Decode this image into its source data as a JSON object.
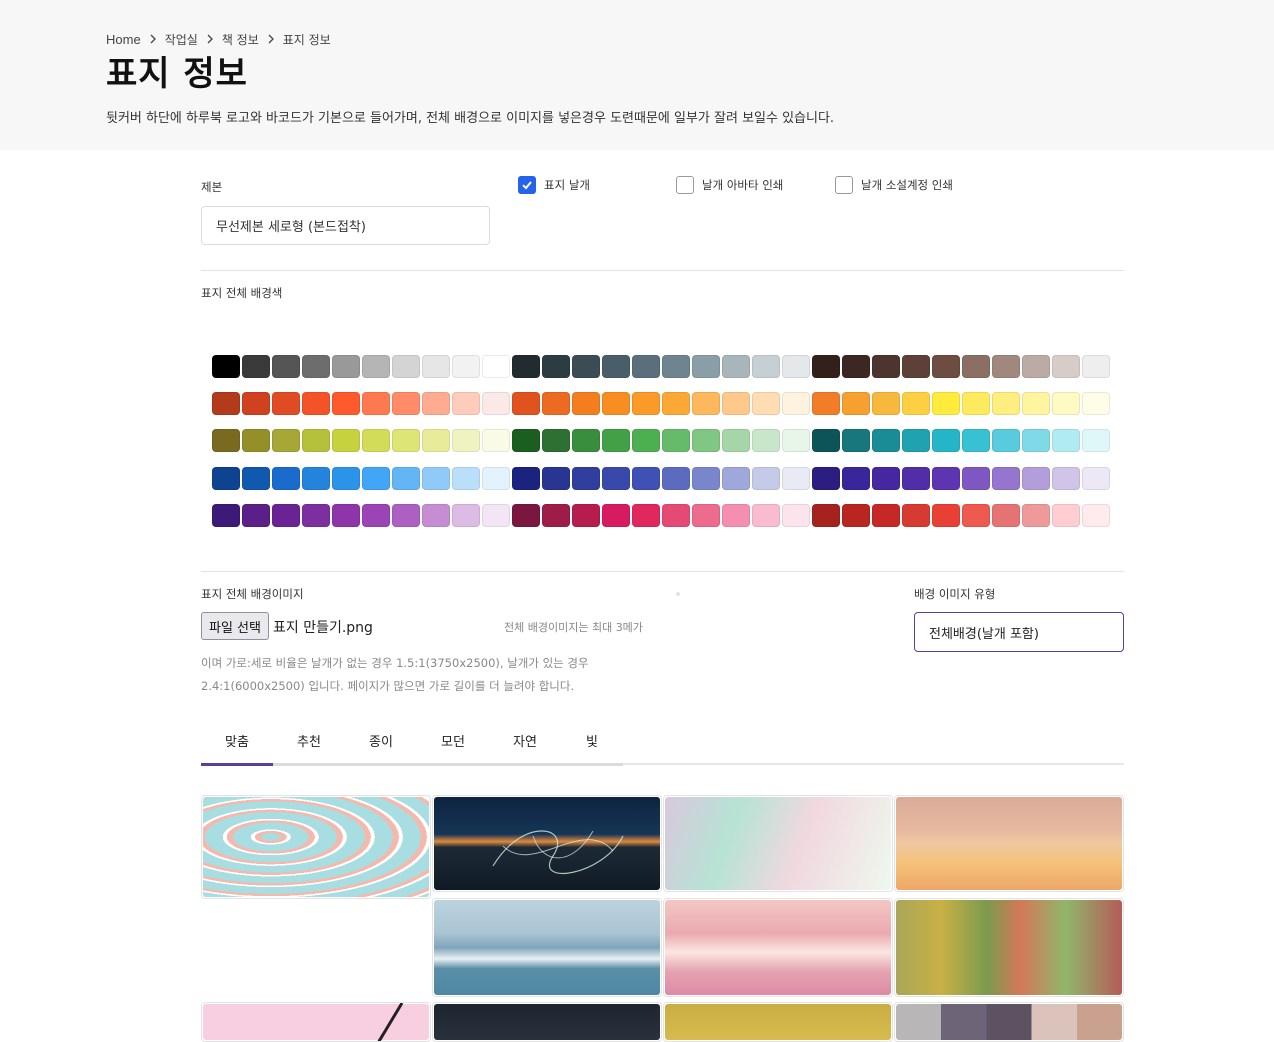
{
  "breadcrumb": [
    {
      "label": "Home"
    },
    {
      "label": "작업실"
    },
    {
      "label": "책 정보"
    },
    {
      "label": "표지 정보"
    }
  ],
  "page": {
    "title": "표지 정보",
    "description": "뒷커버 하단에 하루북 로고와 바코드가 기본으로 들어가며, 전체 배경으로 이미지를 넣은경우 도련때문에 일부가 잘려 보일수 있습니다."
  },
  "binding": {
    "label": "제본",
    "value": "무선제본 세로형 (본드접착)"
  },
  "options": [
    {
      "label": "표지 날개",
      "checked": true
    },
    {
      "label": "날개 아바타 인쇄",
      "checked": false
    },
    {
      "label": "날개 소설계정 인쇄",
      "checked": false
    }
  ],
  "bg_color": {
    "label": "표지 전체 배경색",
    "rows": [
      [
        "#000000",
        "#3a3a3a",
        "#555555",
        "#6d6d6d",
        "#999999",
        "#b5b5b5",
        "#d4d4d4",
        "#e6e6e6",
        "#f2f2f2",
        "#ffffff",
        "#212b30",
        "#2d3c43",
        "#3b4c55",
        "#485e69",
        "#5a6f7b",
        "#6e848f",
        "#8a9ea7",
        "#a8b6bc",
        "#c6d0d4",
        "#e4e8ea",
        "#33201b",
        "#3e2723",
        "#4e342e",
        "#5d4037",
        "#6d4c41",
        "#8d6e63",
        "#a1887f",
        "#bcaaa4",
        "#d7ccc8",
        "#eeeeee"
      ],
      [
        "#b33a1b",
        "#d0421f",
        "#e04b24",
        "#f4532a",
        "#ff5a2c",
        "#ff7a50",
        "#ff8b69",
        "#ffab91",
        "#ffccbc",
        "#fbe9e7",
        "#e0531e",
        "#ec6a22",
        "#f47d20",
        "#f88e22",
        "#fb9a28",
        "#fca837",
        "#fdb75c",
        "#fec98a",
        "#ffdcb2",
        "#fff3e0",
        "#f27d28",
        "#f5a031",
        "#f7b93d",
        "#fdd043",
        "#ffeb3b",
        "#fdea5e",
        "#feed7f",
        "#fff4a0",
        "#fff9c4",
        "#fffde7"
      ],
      [
        "#7a6a1f",
        "#958f2a",
        "#a6a734",
        "#b6c13b",
        "#c7d33e",
        "#d2dc58",
        "#dce575",
        "#e6ec99",
        "#eef3c1",
        "#f9fbe7",
        "#1b5e20",
        "#2e7031",
        "#388e3c",
        "#43a047",
        "#4caf50",
        "#66bb6a",
        "#81c784",
        "#a5d6a7",
        "#c8e6c9",
        "#e8f5e9",
        "#0d5458",
        "#17777d",
        "#1a8c96",
        "#1fa3b1",
        "#24b6c8",
        "#38c0d3",
        "#58cbdc",
        "#7fd9e6",
        "#b0ebf1",
        "#e0f7fa"
      ],
      [
        "#0d4390",
        "#1159af",
        "#1a6ccc",
        "#2383dd",
        "#2b94e8",
        "#42a5f5",
        "#64b5f6",
        "#90caf9",
        "#bbdefb",
        "#e3f2fd",
        "#1a237e",
        "#283593",
        "#303f9f",
        "#3949ab",
        "#3f51b5",
        "#5c6bc0",
        "#7986cb",
        "#9fa8da",
        "#c5cae9",
        "#e8eaf6",
        "#2c1e80",
        "#39269a",
        "#4527a0",
        "#512da8",
        "#5e35b1",
        "#7e57c2",
        "#9575cd",
        "#b39ddb",
        "#d1c4e9",
        "#ede7f6"
      ],
      [
        "#3d1a78",
        "#5a1f88",
        "#6a2394",
        "#7d2fa0",
        "#8e35aa",
        "#9c43b5",
        "#ab60c2",
        "#c58ed3",
        "#dcbbe4",
        "#f3e5f5",
        "#7b1640",
        "#9e1c48",
        "#b71c4f",
        "#d81b60",
        "#e0285f",
        "#e44a74",
        "#ec6b8f",
        "#f48fb1",
        "#f8bbd0",
        "#fce4ec",
        "#a6221e",
        "#b8261f",
        "#c62828",
        "#d63a31",
        "#e94035",
        "#ef5a50",
        "#e57373",
        "#ef9a9a",
        "#ffcdd2",
        "#ffebee"
      ]
    ]
  },
  "bg_image": {
    "label": "표지 전체 배경이미지",
    "file_button": "파일 선택",
    "file_name": "표지 만들기.png",
    "max_note": "전체 배경이미지는 최대 3메가",
    "ratio_note": "이며 가로:세로 비율은 날개가 없는 경우 1.5:1(3750x2500), 날개가 있는 경우 2.4:1(6000x2500) 입니다. 페이지가 많으면 가로 길이를 더 늘려야 합니다."
  },
  "bg_type": {
    "label": "배경 이미지 유형",
    "value": "전체배경(날개 포함)"
  },
  "tabs": [
    {
      "label": "맞춤",
      "active": true
    },
    {
      "label": "추천",
      "active": false
    },
    {
      "label": "종이",
      "active": false
    },
    {
      "label": "모던",
      "active": false
    },
    {
      "label": "자연",
      "active": false
    },
    {
      "label": "빛",
      "active": false
    }
  ],
  "thumbnails": [
    {
      "name": "marble-pastel"
    },
    {
      "name": "light-trails-night"
    },
    {
      "name": "pastel-gradient"
    },
    {
      "name": "sunset-watercolor"
    },
    {
      "name": "ocean-waves"
    },
    {
      "name": "pink-watercolor"
    },
    {
      "name": "abstract-blocks"
    },
    {
      "name": "pink-line"
    },
    {
      "name": "dark-sky"
    },
    {
      "name": "gold-texture"
    },
    {
      "name": "mauve-stripes"
    }
  ],
  "icons": {
    "breadcrumb_separator": "chevron-right-icon",
    "checkbox_checked": "check-icon"
  },
  "colors": {
    "accent": "#5b3fa0",
    "checkbox": "#2563eb",
    "header_bg": "#f7f7f7"
  }
}
